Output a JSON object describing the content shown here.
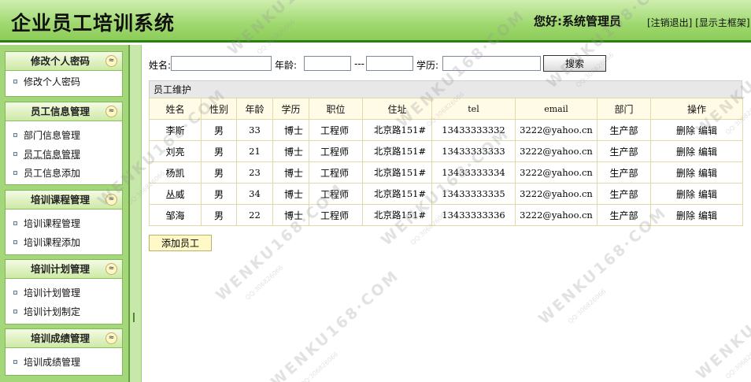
{
  "header": {
    "title": "企业员工培训系统",
    "greeting": "您好:系统管理员",
    "logout": "[注销退出]",
    "show_frame": "[显示主框架]"
  },
  "sidebar": {
    "groups": [
      {
        "title": "修改个人密码",
        "items": [
          "修改个人密码"
        ]
      },
      {
        "title": "员工信息管理",
        "items": [
          "部门信息管理",
          "员工信息管理",
          "员工信息添加"
        ]
      },
      {
        "title": "培训课程管理",
        "items": [
          "培训课程管理",
          "培训课程添加"
        ]
      },
      {
        "title": "培训计划管理",
        "items": [
          "培训计划管理",
          "培训计划制定"
        ]
      },
      {
        "title": "培训成绩管理",
        "items": [
          "培训成绩管理"
        ]
      }
    ],
    "collapse_glyph": "≈"
  },
  "search": {
    "name_label": "姓名:",
    "age_label": "年龄:",
    "range_sep": "---",
    "edu_label": "学历:",
    "button": "搜索"
  },
  "panel": {
    "title": "员工维护",
    "columns": [
      "姓名",
      "性别",
      "年龄",
      "学历",
      "职位",
      "住址",
      "tel",
      "email",
      "部门",
      "操作"
    ],
    "rows": [
      [
        "李斯",
        "男",
        "33",
        "博士",
        "工程师",
        "北京路151#",
        "13433333332",
        "3222@yahoo.cn",
        "生产部"
      ],
      [
        "刘亮",
        "男",
        "21",
        "博士",
        "工程师",
        "北京路151#",
        "13433333333",
        "3222@yahoo.cn",
        "生产部"
      ],
      [
        "杨凯",
        "男",
        "23",
        "博士",
        "工程师",
        "北京路151#",
        "13433333334",
        "3222@yahoo.cn",
        "生产部"
      ],
      [
        "丛威",
        "男",
        "34",
        "博士",
        "工程师",
        "北京路151#",
        "13433333335",
        "3222@yahoo.cn",
        "生产部"
      ],
      [
        "邹海",
        "男",
        "22",
        "博士",
        "工程师",
        "北京路151#",
        "13433333336",
        "3222@yahoo.cn",
        "生产部"
      ]
    ],
    "delete_label": "删除",
    "edit_label": "编辑"
  },
  "add_button": "添加员工",
  "watermark": {
    "text": "WENKU168·COM",
    "sub": "QQ:306826066"
  }
}
